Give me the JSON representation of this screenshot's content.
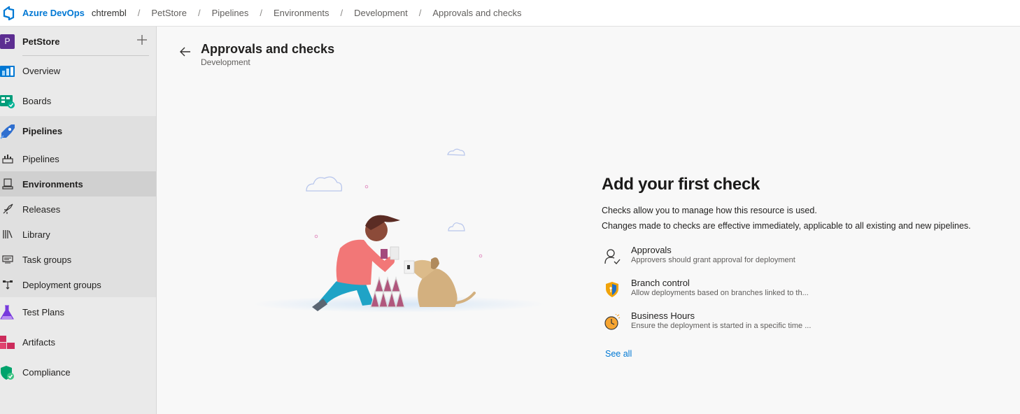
{
  "topbar": {
    "brand": "Azure DevOps",
    "breadcrumbs": [
      "chtrembl",
      "PetStore",
      "Pipelines",
      "Environments",
      "Development",
      "Approvals and checks"
    ],
    "separator": "/"
  },
  "sidebar": {
    "project": {
      "initial": "P",
      "name": "PetStore",
      "add_icon": "plus-icon"
    },
    "items": [
      {
        "label": "Overview",
        "icon": "overview-icon"
      },
      {
        "label": "Boards",
        "icon": "boards-icon"
      },
      {
        "label": "Pipelines",
        "icon": "pipelines-icon"
      },
      {
        "label": "Pipelines",
        "icon": "pipelines-sub-icon"
      },
      {
        "label": "Environments",
        "icon": "environments-icon",
        "selected": true
      },
      {
        "label": "Releases",
        "icon": "releases-icon"
      },
      {
        "label": "Library",
        "icon": "library-icon"
      },
      {
        "label": "Task groups",
        "icon": "task-groups-icon"
      },
      {
        "label": "Deployment groups",
        "icon": "deployment-groups-icon"
      },
      {
        "label": "Test Plans",
        "icon": "test-plans-icon"
      },
      {
        "label": "Artifacts",
        "icon": "artifacts-icon"
      },
      {
        "label": "Compliance",
        "icon": "compliance-icon"
      }
    ]
  },
  "main": {
    "title": "Approvals and checks",
    "subtitle": "Development",
    "empty_state": {
      "heading": "Add your first check",
      "desc1": "Checks allow you to manage how this resource is used.",
      "desc2": "Changes made to checks are effective immediately, applicable to all existing and new pipelines.",
      "checks": [
        {
          "title": "Approvals",
          "desc": "Approvers should grant approval for deployment",
          "icon": "approvals-icon"
        },
        {
          "title": "Branch control",
          "desc": "Allow deployments based on branches linked to th...",
          "icon": "branch-control-icon"
        },
        {
          "title": "Business Hours",
          "desc": "Ensure the deployment is started in a specific time ...",
          "icon": "business-hours-icon"
        }
      ],
      "see_all": "See all"
    }
  },
  "colors": {
    "accent": "#0078d4",
    "project": "#5c2d91"
  }
}
